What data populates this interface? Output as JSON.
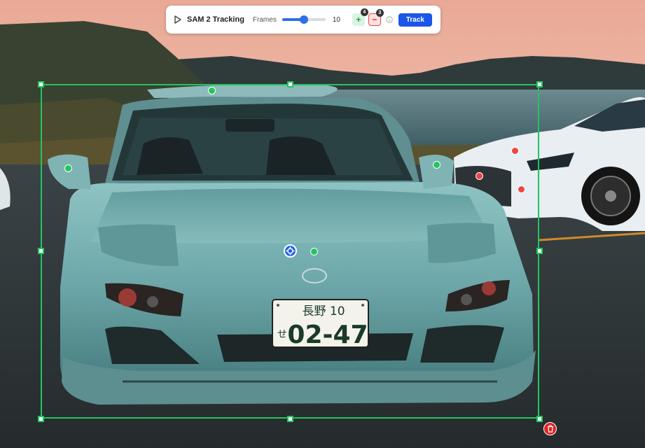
{
  "toolbar": {
    "play_icon": "play-icon",
    "title": "SAM 2 Tracking",
    "frames_label": "Frames",
    "frames_value": "10",
    "frames_fraction": 0.5,
    "positive_points_count": "4",
    "positive_symbol": "+",
    "negative_points_count": "3",
    "negative_symbol": "−",
    "info_icon": "info-icon",
    "track_label": "Track"
  },
  "plate": {
    "line1": "長野 10",
    "line2_prefix": "せ",
    "line2_number": "02-47"
  },
  "colors": {
    "accent": "#1a56e8",
    "bbox": "#22c55e",
    "positive": "#22c55e",
    "negative": "#ef4444",
    "delete": "#dc2626"
  }
}
